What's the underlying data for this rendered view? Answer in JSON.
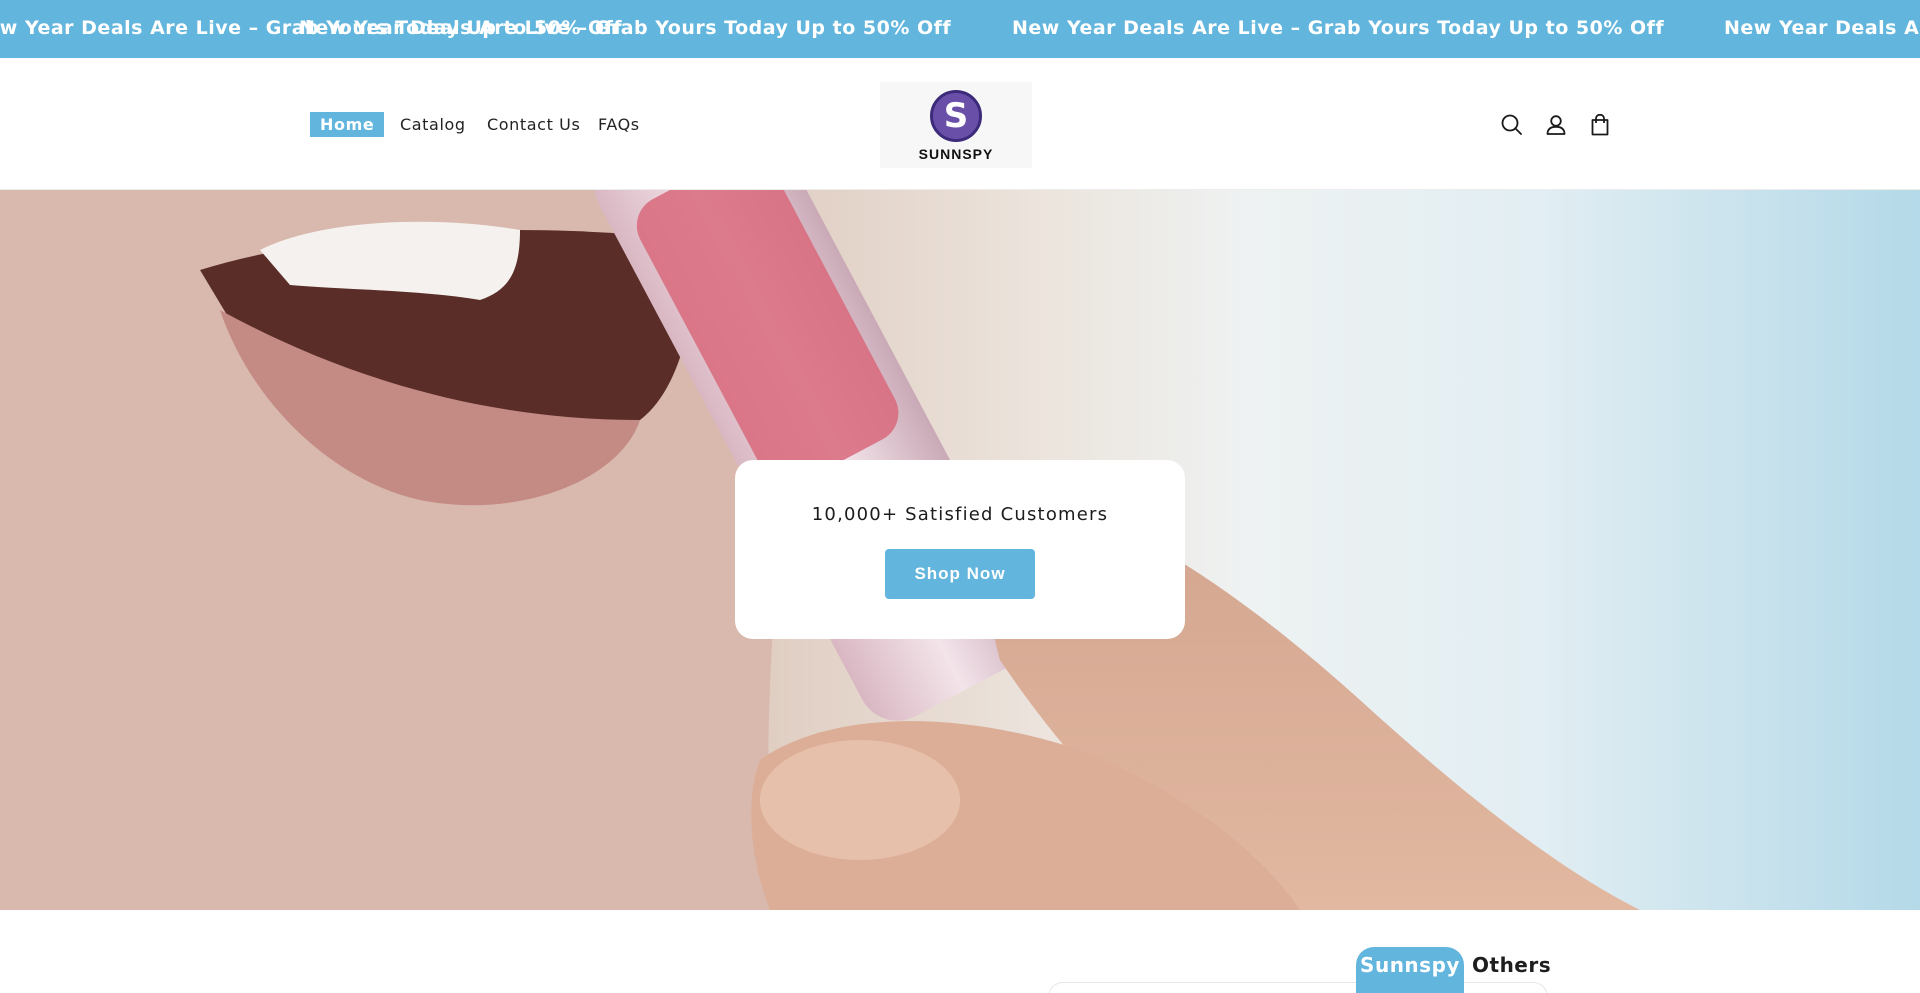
{
  "announcement": {
    "items": [
      "New Year Deals Are Live – Grab Yours Today Up to 50% Off",
      "New Year Deals Are Live – Grab Yours Today Up to 50% Off",
      "New Year Deals Are Live – Grab Yours Today Up to 50% Off",
      "New Year Deals Are Live – Grab Yours Today Up to 50% Off"
    ]
  },
  "nav": {
    "items": [
      {
        "label": "Home",
        "active": true
      },
      {
        "label": "Catalog",
        "active": false
      },
      {
        "label": "Contact Us",
        "active": false
      },
      {
        "label": "FAQs",
        "active": false
      }
    ]
  },
  "logo": {
    "letter": "S",
    "text": "SUNNSPY"
  },
  "header_icons": [
    "search-icon",
    "account-icon",
    "cart-icon"
  ],
  "hero": {
    "tagline": "10,000+ Satisfied Customers",
    "cta_label": "Shop Now"
  },
  "tabs": [
    {
      "label": "Sunnspy",
      "active": true
    },
    {
      "label": "Others",
      "active": false
    }
  ],
  "colors": {
    "accent": "#62b5dc",
    "logo_purple": "#6a4fa8"
  }
}
